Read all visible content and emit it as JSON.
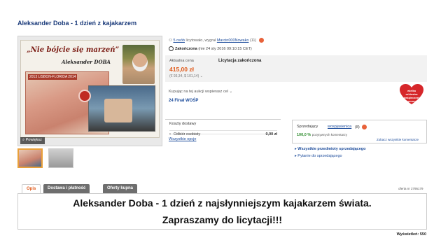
{
  "listing": {
    "title": "Aleksander Doba - 1 dzień z kajakarzem"
  },
  "gallery": {
    "promo_quote": "„Nie bójcie się marzeń”",
    "promo_name": "Aleksander DOBA",
    "promo_map_caption": "2013 LISBON-FLORIDA 2014",
    "zoom_label": "Powiększ",
    "thumbnails": [
      "thumbnail-1",
      "thumbnail-2"
    ]
  },
  "auction": {
    "bidders_link": "5 osób",
    "bidders_text": "licytowało, wygrał",
    "winner": "Marcin000Nowako",
    "winner_score": "(11)",
    "ended_label": "Zakończona",
    "ended_date": "(nie 24 sty 2016 09:10:15 CET)",
    "current_price_label": "Aktualna cena",
    "price": "415,00 zł",
    "price_conversion": "(€ 93,34, $ 101,14)",
    "status": "Licytacja zakończona",
    "charity_text": "Kupując na tej aukcji wspierasz cel",
    "charity_name": "24 Finał WOŚP",
    "wosp_badge": "wielka orkiestra świątecznej pomocy"
  },
  "shipping": {
    "title": "Koszty dostawy",
    "method": "Odbiór osobisty",
    "cost": "0,00 zł",
    "all_options_link": "Wszystkie opcje"
  },
  "seller": {
    "label": "Sprzedający",
    "name": "wospjasienica",
    "score": "(8)",
    "positive_pct": "100,0 %",
    "positive_text": "pozytywnych komentarzy",
    "all_comments_link": "Zobacz wszystkie komentarze",
    "all_items_link": "Wszystkie przedmioty sprzedającego",
    "ask_link": "Pytanie do sprzedającego"
  },
  "tabs": [
    {
      "label": "Opis"
    },
    {
      "label": "Dostawa i płatność"
    },
    {
      "label": "Oferty kupna"
    }
  ],
  "offer_number": "oferta nr 2795179",
  "description": {
    "line1": "Aleksander Doba  - 1 dzień z najsłynniejszym kajakarzem świata.",
    "line2": "Zapraszamy do licytacji!!!"
  },
  "views": "Wyświetleń: 550",
  "colors": {
    "link": "#1a4a9a",
    "price": "#e05a1a",
    "positive": "#2a8a2a",
    "wosp_red": "#d6262a"
  }
}
